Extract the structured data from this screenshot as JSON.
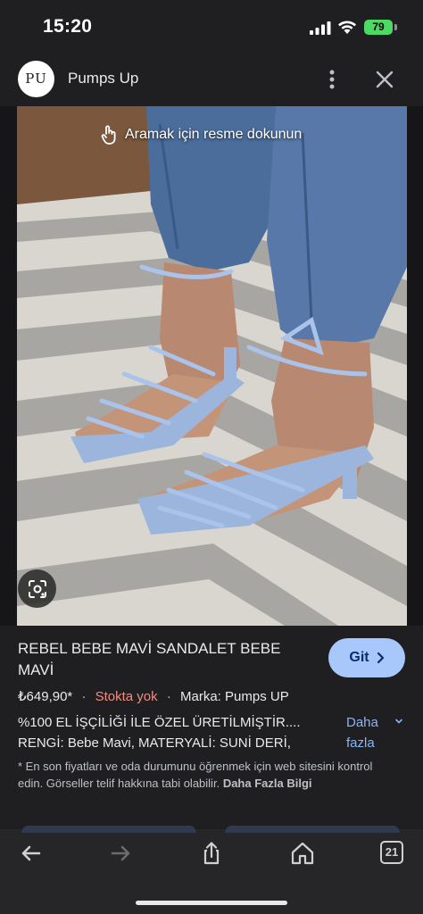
{
  "status_bar": {
    "time": "15:20",
    "battery": "79"
  },
  "header": {
    "logo_text": "PU",
    "site_name": "Pumps Up"
  },
  "image": {
    "tap_hint": "Aramak için resme dokunun"
  },
  "product": {
    "title": "REBEL BEBE MAVİ SANDALET BEBE MAVİ",
    "go_button": "Git",
    "price": "₺649,90*",
    "stock": "Stokta yok",
    "brand": "Marka: Pumps UP",
    "desc_line1": "%100 EL İŞÇİLİĞİ İLE ÖZEL ÜRETİLMİŞTİR....",
    "desc_line2": "RENGİ: Bebe Mavi, MATERYALİ: SUNİ DERİ,",
    "more_label": "Daha fazla",
    "note_text": "* En son fiyatları ve oda durumunu öğrenmek için web sitesini kontrol edin. Görseller telif hakkına tabi olabilir.",
    "note_link": "Daha Fazla Bilgi"
  },
  "toolbar": {
    "tab_count": "21"
  },
  "colors": {
    "accent_button": "#a8c7fa",
    "stock_red": "#f28b82",
    "link_blue": "#8ab4f8",
    "battery_green": "#4cd964"
  }
}
